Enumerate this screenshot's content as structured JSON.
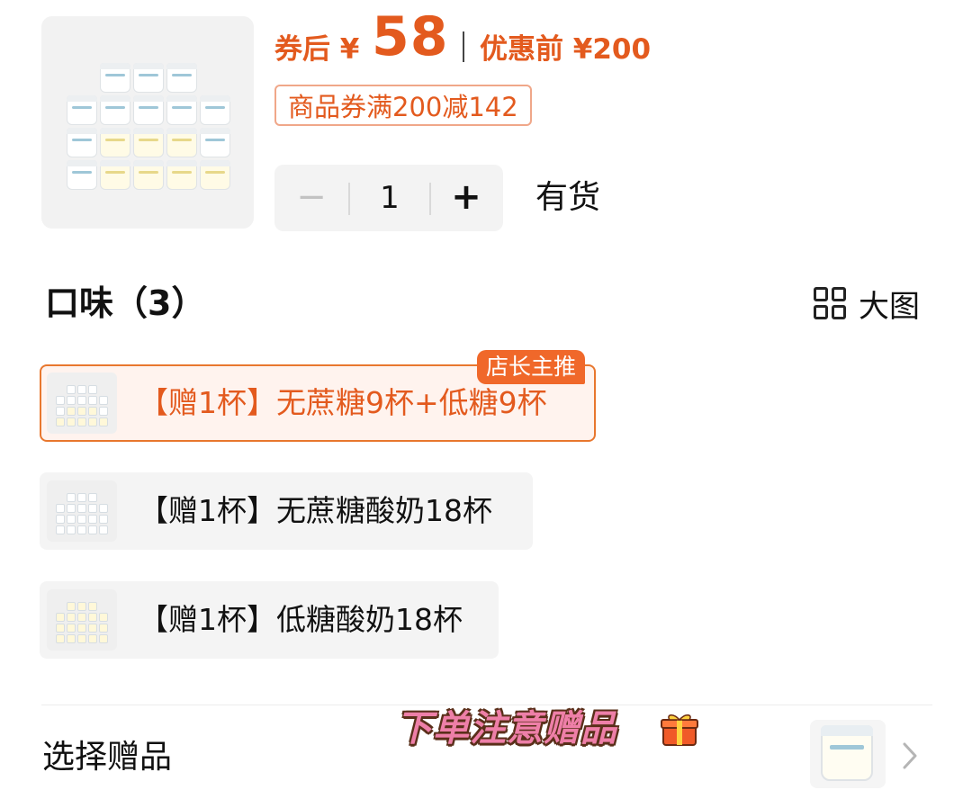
{
  "product": {
    "price_prefix": "券后 ¥",
    "price": "58",
    "original_price": "优惠前 ¥200",
    "coupon": "商品券满200减142",
    "quantity": "1",
    "minus": "−",
    "plus": "+",
    "stock_status": "有货"
  },
  "flavor": {
    "title": "口味（3）",
    "big_view_label": "大图",
    "badge": "店长主推",
    "options": [
      {
        "label": "【赠1杯】无蔗糖9杯+低糖9杯",
        "selected": true
      },
      {
        "label": "【赠1杯】无蔗糖酸奶18杯",
        "selected": false
      },
      {
        "label": "【赠1杯】低糖酸奶18杯",
        "selected": false
      }
    ]
  },
  "gift": {
    "label": "选择赠品",
    "banner": "下单注意赠品"
  },
  "colors": {
    "accent": "#e35a1e",
    "badge_bg": "#f0682a",
    "selected_bg": "#fff3ee",
    "banner_pink": "#ee7fa8"
  },
  "icons": [
    "grid-icon",
    "gift-box-icon",
    "chevron-right-icon"
  ]
}
